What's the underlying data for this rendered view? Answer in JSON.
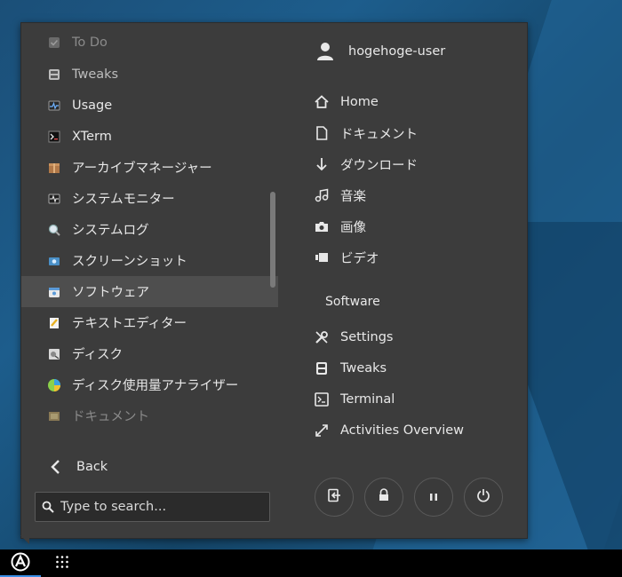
{
  "app_list": {
    "items": [
      {
        "label": "To Do",
        "icon": "todo-icon",
        "state": "faded"
      },
      {
        "label": "Tweaks",
        "icon": "tweaks-icon",
        "state": ""
      },
      {
        "label": "Usage",
        "icon": "usage-icon",
        "state": ""
      },
      {
        "label": "XTerm",
        "icon": "xterm-icon",
        "state": ""
      },
      {
        "label": "アーカイブマネージャー",
        "icon": "archive-manager-icon",
        "state": ""
      },
      {
        "label": "システムモニター",
        "icon": "system-monitor-icon",
        "state": ""
      },
      {
        "label": "システムログ",
        "icon": "system-log-icon",
        "state": ""
      },
      {
        "label": "スクリーンショット",
        "icon": "screenshot-icon",
        "state": ""
      },
      {
        "label": "ソフトウェア",
        "icon": "software-icon",
        "state": "selected"
      },
      {
        "label": "テキストエディター",
        "icon": "text-editor-icon",
        "state": ""
      },
      {
        "label": "ディスク",
        "icon": "disks-icon",
        "state": ""
      },
      {
        "label": "ディスク使用量アナライザー",
        "icon": "disk-usage-analyzer-icon",
        "state": ""
      },
      {
        "label": "ドキュメント",
        "icon": "documents-icon",
        "state": "faded"
      }
    ],
    "back_label": "Back",
    "search_placeholder": "Type to search..."
  },
  "user": {
    "name": "hogehoge-user"
  },
  "places": [
    {
      "label": "Home",
      "icon": "home-icon"
    },
    {
      "label": "ドキュメント",
      "icon": "document-icon"
    },
    {
      "label": "ダウンロード",
      "icon": "download-icon"
    },
    {
      "label": "音楽",
      "icon": "music-icon"
    },
    {
      "label": "画像",
      "icon": "camera-icon"
    },
    {
      "label": "ビデオ",
      "icon": "video-icon"
    }
  ],
  "software": {
    "title": "Software",
    "items": [
      {
        "label": "Settings",
        "icon": "settings-icon"
      },
      {
        "label": "Tweaks",
        "icon": "tweaks-icon"
      },
      {
        "label": "Terminal",
        "icon": "terminal-icon"
      },
      {
        "label": "Activities Overview",
        "icon": "activities-overview-icon"
      }
    ]
  },
  "power_buttons": [
    {
      "name": "logout-icon"
    },
    {
      "name": "lock-icon"
    },
    {
      "name": "suspend-icon"
    },
    {
      "name": "power-icon"
    }
  ],
  "taskbar": {
    "menu_icon": "arc-menu-icon",
    "apps_icon": "app-grid-icon"
  },
  "colors": {
    "panel_bg": "#3c3c3c",
    "selected_bg": "#4e4e4e",
    "text": "#e8e8e8",
    "accent": "#3a8ee6"
  }
}
